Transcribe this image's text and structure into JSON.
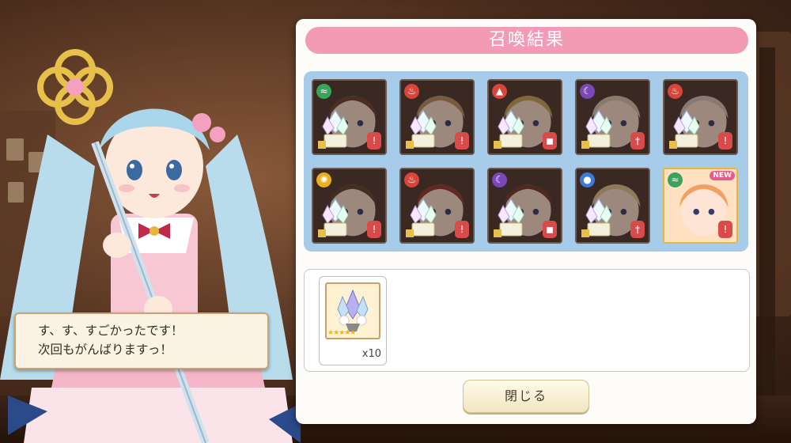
{
  "title": "召喚結果",
  "dialogue": {
    "line1": "す、す、すごかったです！",
    "line2": "次回もがんばりますっ！"
  },
  "results": [
    {
      "element_icon": "wave-icon",
      "element_color": "#3aa55a",
      "role_icon": "staff-icon",
      "crystal": true,
      "highlight": false,
      "new": false,
      "portrait_color": "#6a4032"
    },
    {
      "element_icon": "flame-icon",
      "element_color": "#d9453a",
      "role_icon": "staff-icon",
      "crystal": true,
      "highlight": false,
      "new": false,
      "portrait_color": "#b89068"
    },
    {
      "element_icon": "earth-icon",
      "element_color": "#d9453a",
      "role_icon": "shield-icon",
      "crystal": true,
      "highlight": false,
      "new": false,
      "portrait_color": "#c9a85a"
    },
    {
      "element_icon": "moon-icon",
      "element_color": "#7a48b8",
      "role_icon": "sword-icon",
      "crystal": true,
      "highlight": false,
      "new": false,
      "portrait_color": "#d8ccb8"
    },
    {
      "element_icon": "flame-icon",
      "element_color": "#d9453a",
      "role_icon": "staff-icon",
      "crystal": true,
      "highlight": false,
      "new": false,
      "portrait_color": "#d8c8c0"
    },
    {
      "element_icon": "sun-icon",
      "element_color": "#e6b020",
      "role_icon": "staff-icon",
      "crystal": true,
      "highlight": false,
      "new": false,
      "portrait_color": "#5a4030"
    },
    {
      "element_icon": "flame-icon",
      "element_color": "#d9453a",
      "role_icon": "staff-icon",
      "crystal": true,
      "highlight": false,
      "new": false,
      "portrait_color": "#8a3a30"
    },
    {
      "element_icon": "moon-icon",
      "element_color": "#7a48b8",
      "role_icon": "shield-icon",
      "crystal": true,
      "highlight": false,
      "new": false,
      "portrait_color": "#6a3a28"
    },
    {
      "element_icon": "water-icon",
      "element_color": "#3a7ad9",
      "role_icon": "sword-icon",
      "crystal": true,
      "highlight": false,
      "new": false,
      "portrait_color": "#e0c898"
    },
    {
      "element_icon": "wave-icon",
      "element_color": "#3aa55a",
      "role_icon": "staff-icon",
      "crystal": false,
      "highlight": true,
      "new": true,
      "new_label": "NEW",
      "portrait_color": "#f0a060"
    }
  ],
  "item": {
    "icon": "crystal-bouquet-icon",
    "stars": "★★★★★",
    "count": "x10"
  },
  "close_label": "閉じる"
}
